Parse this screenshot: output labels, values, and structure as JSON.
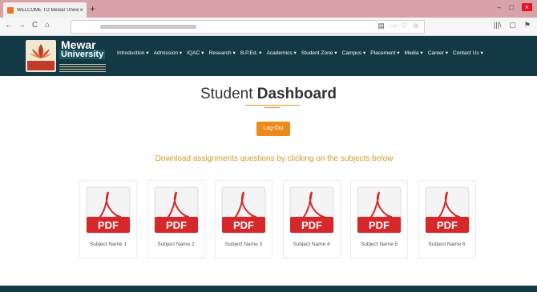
{
  "browser": {
    "tab_title": "WELCOME TO Mewar Univers",
    "tab_close": "×",
    "new_tab": "+",
    "nav": {
      "back": "←",
      "forward": "→",
      "reload": "C",
      "home": "⌂"
    },
    "url_actions": [
      "▤",
      "···",
      "♡",
      "☆"
    ],
    "toolbar_right": [
      "|||\\",
      "▢",
      "⚑"
    ],
    "window_controls": [
      "–",
      "□",
      "×"
    ]
  },
  "site": {
    "logo": {
      "name_line1": "Mewar",
      "name_line2": "University"
    },
    "menu": [
      "Introduction ▾",
      "Admission ▾",
      "IQAC ▾",
      "Research ▾",
      "B.P.Ed. ▾",
      "Academics ▾",
      "Student Zone ▾",
      "Campus ▾",
      "Placement ▾",
      "Media ▾",
      "Career ▾",
      "Contact Us ▾"
    ]
  },
  "dashboard": {
    "title_light": "Student ",
    "title_bold": "Dashboard",
    "logout_label": "Log-Out",
    "instruction": "Download assignments questions by clicking on the subjects below",
    "pdf_label": "PDF",
    "subjects": [
      {
        "label": "Subject Name 1"
      },
      {
        "label": "Subject Name 2"
      },
      {
        "label": "Subject Name 3"
      },
      {
        "label": "Subject Name 4"
      },
      {
        "label": "Subject Name 5"
      },
      {
        "label": "Subject Name 6"
      }
    ]
  },
  "colors": {
    "header_bg": "#133a44",
    "accent_orange": "#ec8b1a",
    "instruction_text": "#d49a2b",
    "pdf_red": "#d6282a",
    "tabbar": "#d8a2a8"
  }
}
